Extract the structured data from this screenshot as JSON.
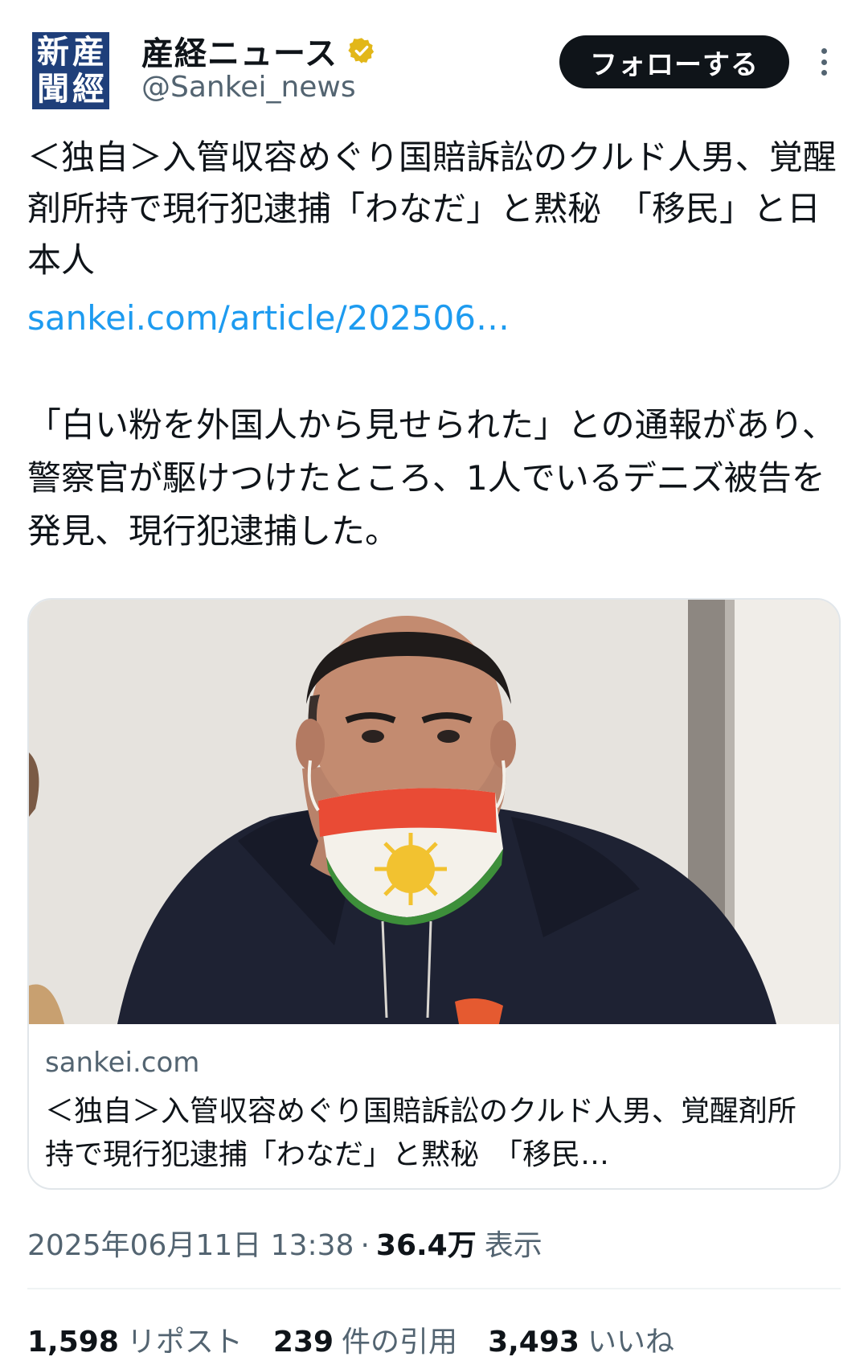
{
  "header": {
    "avatar_glyphs": [
      "産",
      "經",
      "新",
      "聞"
    ],
    "account_name": "産経ニュース",
    "handle": "@Sankei_news",
    "follow_label": "フォローする"
  },
  "post": {
    "text_1": "＜独自＞入管収容めぐり国賠訴訟のクルド人男、覚醒剤所持で現行犯逮捕「わなだ」と黙秘　「移民」と日本人",
    "link": "sankei.com/article/202506…",
    "text_2": "「白い粉を外国人から見せられた」との通報があり、警察官が駆けつけたところ、1人でいるデニズ被告を発見、現行犯逮捕した。"
  },
  "card": {
    "domain": "sankei.com",
    "title": "＜独自＞入管収容めぐり国賠訴訟のクルド人男、覚醒剤所持で現行犯逮捕「わなだ」と黙秘　「移民…"
  },
  "meta": {
    "datetime": "2025年06月11日 13:38",
    "separator": "·",
    "views": "36.4万",
    "views_label": "表示"
  },
  "stats": {
    "reposts": "1,598",
    "reposts_label": "リポスト",
    "quotes": "239",
    "quotes_label": "件の引用",
    "likes": "3,493",
    "likes_label": "いいね"
  },
  "colors": {
    "link": "#1d9bf0",
    "verified": "#e2b719",
    "avatar_bg": "#1f3f7a",
    "follow_bg": "#0f1419"
  },
  "icons": {
    "verified": "verified-badge-icon",
    "more": "more-options-icon"
  }
}
